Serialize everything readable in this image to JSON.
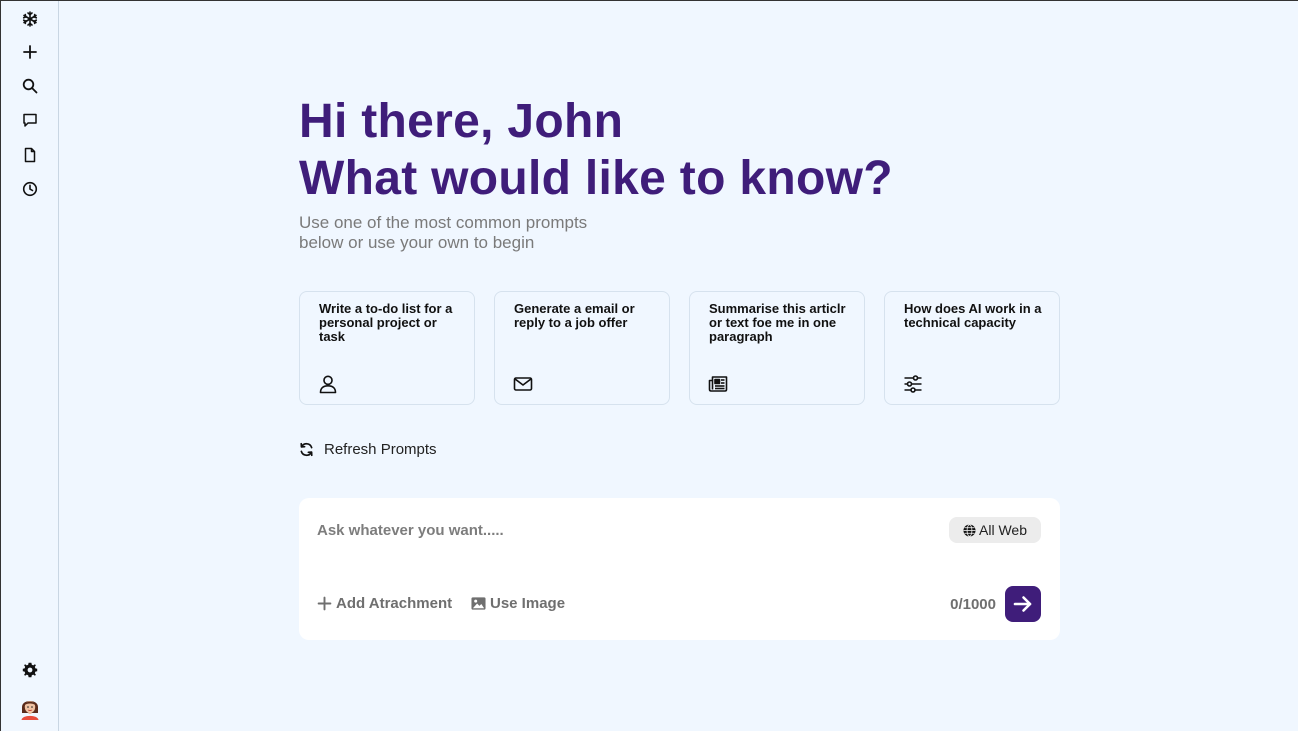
{
  "colors": {
    "accent": "#3f1d7a",
    "background": "#f0f7ff",
    "card_border": "#d6e2ee"
  },
  "sidebar": {
    "top_items": [
      {
        "icon": "snowflake-icon"
      },
      {
        "icon": "plus-icon"
      },
      {
        "icon": "search-icon"
      },
      {
        "icon": "chat-icon"
      },
      {
        "icon": "document-icon"
      },
      {
        "icon": "clock-icon"
      }
    ],
    "bottom_items": [
      {
        "icon": "gear-icon"
      },
      {
        "icon": "avatar"
      }
    ]
  },
  "greeting": {
    "line1": "Hi there, John",
    "line2": "What would like to know?",
    "subtitle": "Use one of the most common prompts below or use your own to begin"
  },
  "prompts": [
    {
      "text": "Write a to-do list for a personal project or task",
      "icon": "user-icon"
    },
    {
      "text": "Generate a email or reply to a job offer",
      "icon": "mail-icon"
    },
    {
      "text": "Summarise this articlr or text foe me in one paragraph",
      "icon": "newspaper-icon"
    },
    {
      "text": "How does AI work in a technical capacity",
      "icon": "sliders-icon"
    }
  ],
  "refresh_label": "Refresh Prompts",
  "ask": {
    "placeholder": "Ask whatever you want.....",
    "scope_label": "All Web",
    "attach_label": "Add Atrachment",
    "image_label": "Use Image",
    "counter": "0/1000"
  }
}
